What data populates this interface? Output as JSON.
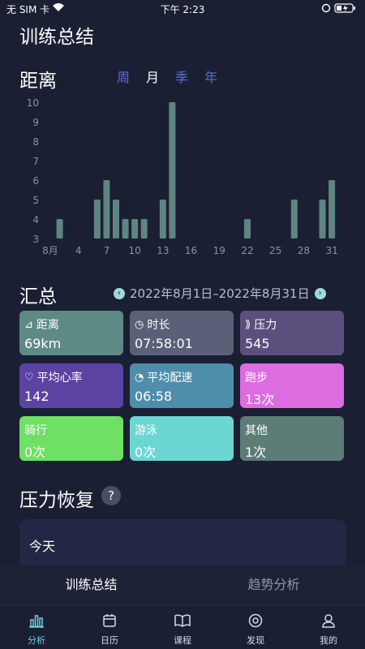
{
  "status_bar": {
    "carrier": "无 SIM 卡",
    "time": "下午 2:23",
    "right_icons": "orientation-lock, battery-charging"
  },
  "page_title": "训练总结",
  "distance_section": {
    "title": "距离",
    "period_tabs": [
      {
        "label": "周",
        "active": false
      },
      {
        "label": "月",
        "active": true
      },
      {
        "label": "季",
        "active": false
      },
      {
        "label": "年",
        "active": false
      }
    ]
  },
  "chart_data": {
    "type": "bar",
    "title": "",
    "xlabel": "",
    "ylabel": "",
    "ylim": [
      3,
      10
    ],
    "yticks": [
      3,
      4,
      5,
      6,
      7,
      8,
      9,
      10
    ],
    "xtick_labels": [
      {
        "day": 1,
        "label": "8月"
      },
      {
        "day": 4,
        "label": "4"
      },
      {
        "day": 7,
        "label": "7"
      },
      {
        "day": 10,
        "label": "10"
      },
      {
        "day": 13,
        "label": "13"
      },
      {
        "day": 16,
        "label": "16"
      },
      {
        "day": 19,
        "label": "19"
      },
      {
        "day": 22,
        "label": "22"
      },
      {
        "day": 25,
        "label": "25"
      },
      {
        "day": 28,
        "label": "28"
      },
      {
        "day": 31,
        "label": "31"
      }
    ],
    "bars": [
      {
        "day": 2,
        "value": 4
      },
      {
        "day": 6,
        "value": 5
      },
      {
        "day": 7,
        "value": 6
      },
      {
        "day": 8,
        "value": 5
      },
      {
        "day": 9,
        "value": 4
      },
      {
        "day": 10,
        "value": 4
      },
      {
        "day": 11,
        "value": 4
      },
      {
        "day": 13,
        "value": 5
      },
      {
        "day": 14,
        "value": 10
      },
      {
        "day": 22,
        "value": 4
      },
      {
        "day": 27,
        "value": 5
      },
      {
        "day": 30,
        "value": 5
      },
      {
        "day": 31,
        "value": 6
      }
    ],
    "grid": false,
    "colors": {
      "bar": "#5e8581",
      "tick": "#8c91a6"
    }
  },
  "summary": {
    "title": "汇总",
    "range_label": "2022年8月1日–2022年8月31日",
    "cards": [
      {
        "label": "距离",
        "value": "69km",
        "icon": "distance-icon",
        "icon_glyph": "⊿",
        "color": "#5e8a86"
      },
      {
        "label": "时长",
        "value": "07:58:01",
        "icon": "clock-icon",
        "icon_glyph": "◷",
        "color": "#5a6077"
      },
      {
        "label": "压力",
        "value": "545",
        "icon": "stress-icon",
        "icon_glyph": "⟫",
        "color": "#5c4e7d"
      },
      {
        "label": "平均心率",
        "value": "142",
        "icon": "heart-rate-icon",
        "icon_glyph": "♡",
        "color": "#5b43a2"
      },
      {
        "label": "平均配速",
        "value": "06:58",
        "icon": "pace-icon",
        "icon_glyph": "◔",
        "color": "#4f8eaa"
      },
      {
        "label": "跑步",
        "value": "13次",
        "icon": "",
        "icon_glyph": "",
        "color": "#dd6ce1"
      },
      {
        "label": "骑行",
        "value": "0次",
        "icon": "",
        "icon_glyph": "",
        "color": "#6ee063"
      },
      {
        "label": "游泳",
        "value": "0次",
        "icon": "",
        "icon_glyph": "",
        "color": "#6bd6d2"
      },
      {
        "label": "其他",
        "value": "1次",
        "icon": "",
        "icon_glyph": "",
        "color": "#5c7c78"
      }
    ]
  },
  "recovery": {
    "title": "压力恢复",
    "help": "?",
    "today_label": "今天"
  },
  "segmented_tabs": [
    {
      "label": "训练总结",
      "active": true
    },
    {
      "label": "趋势分析",
      "active": false
    }
  ],
  "tab_bar": [
    {
      "label": "分析",
      "icon": "chart-icon",
      "active": true
    },
    {
      "label": "日历",
      "icon": "calendar-icon",
      "active": false
    },
    {
      "label": "课程",
      "icon": "book-icon",
      "active": false
    },
    {
      "label": "发现",
      "icon": "compass-icon",
      "active": false
    },
    {
      "label": "我的",
      "icon": "profile-icon",
      "active": false
    }
  ]
}
